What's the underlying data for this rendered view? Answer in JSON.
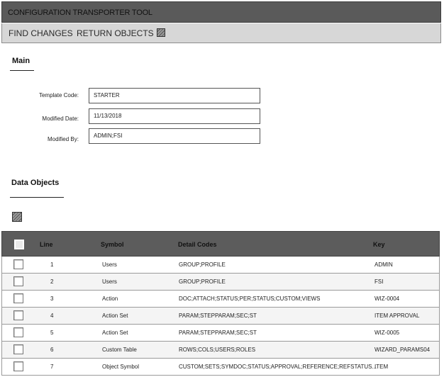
{
  "app": {
    "title": "CONFIGURATION TRANSPORTER TOOL"
  },
  "toolbar": {
    "find_changes": "FIND CHANGES",
    "return_objects": "RETURN OBJECTS",
    "extra_icon": "hatched-square-icon"
  },
  "main": {
    "section_title": "Main",
    "fields": [
      {
        "label": "Template Code:",
        "value": "STARTER"
      },
      {
        "label": "Modified Date:",
        "value": "11/13/2018"
      },
      {
        "label": "Modified By:",
        "value": "ADMIN;FSI"
      }
    ]
  },
  "data_objects": {
    "section_title": "Data Objects",
    "icon": "hatched-square-icon",
    "columns": {
      "line": "Line",
      "symbol": "Symbol",
      "detail": "Detail Codes",
      "key": "Key"
    },
    "rows": [
      {
        "line": "1",
        "symbol": "Users",
        "detail": "GROUP;PROFILE",
        "key": "ADMIN"
      },
      {
        "line": "2",
        "symbol": "Users",
        "detail": "GROUP;PROFILE",
        "key": "FSI"
      },
      {
        "line": "3",
        "symbol": "Action",
        "detail": "DOC;ATTACH;STATUS;PER;STATUS;CUSTOM;VIEWS",
        "key": "WIZ-0004"
      },
      {
        "line": "4",
        "symbol": "Action Set",
        "detail": "PARAM;STEPPARAM;SEC;ST",
        "key": "ITEM APPROVAL"
      },
      {
        "line": "5",
        "symbol": "Action Set",
        "detail": "PARAM;STEPPARAM;SEC;ST",
        "key": "WIZ-0005"
      },
      {
        "line": "6",
        "symbol": "Custom Table",
        "detail": "ROWS;COLS;USERS;ROLES",
        "key": "WIZARD_PARAMS04"
      },
      {
        "line": "7",
        "symbol": "Object Symbol",
        "detail": "CUSTOM;SETS;SYMDOC;STATUS;APPROVAL;REFERENCE;REFSTATUS...",
        "key": "ITEM"
      }
    ]
  }
}
